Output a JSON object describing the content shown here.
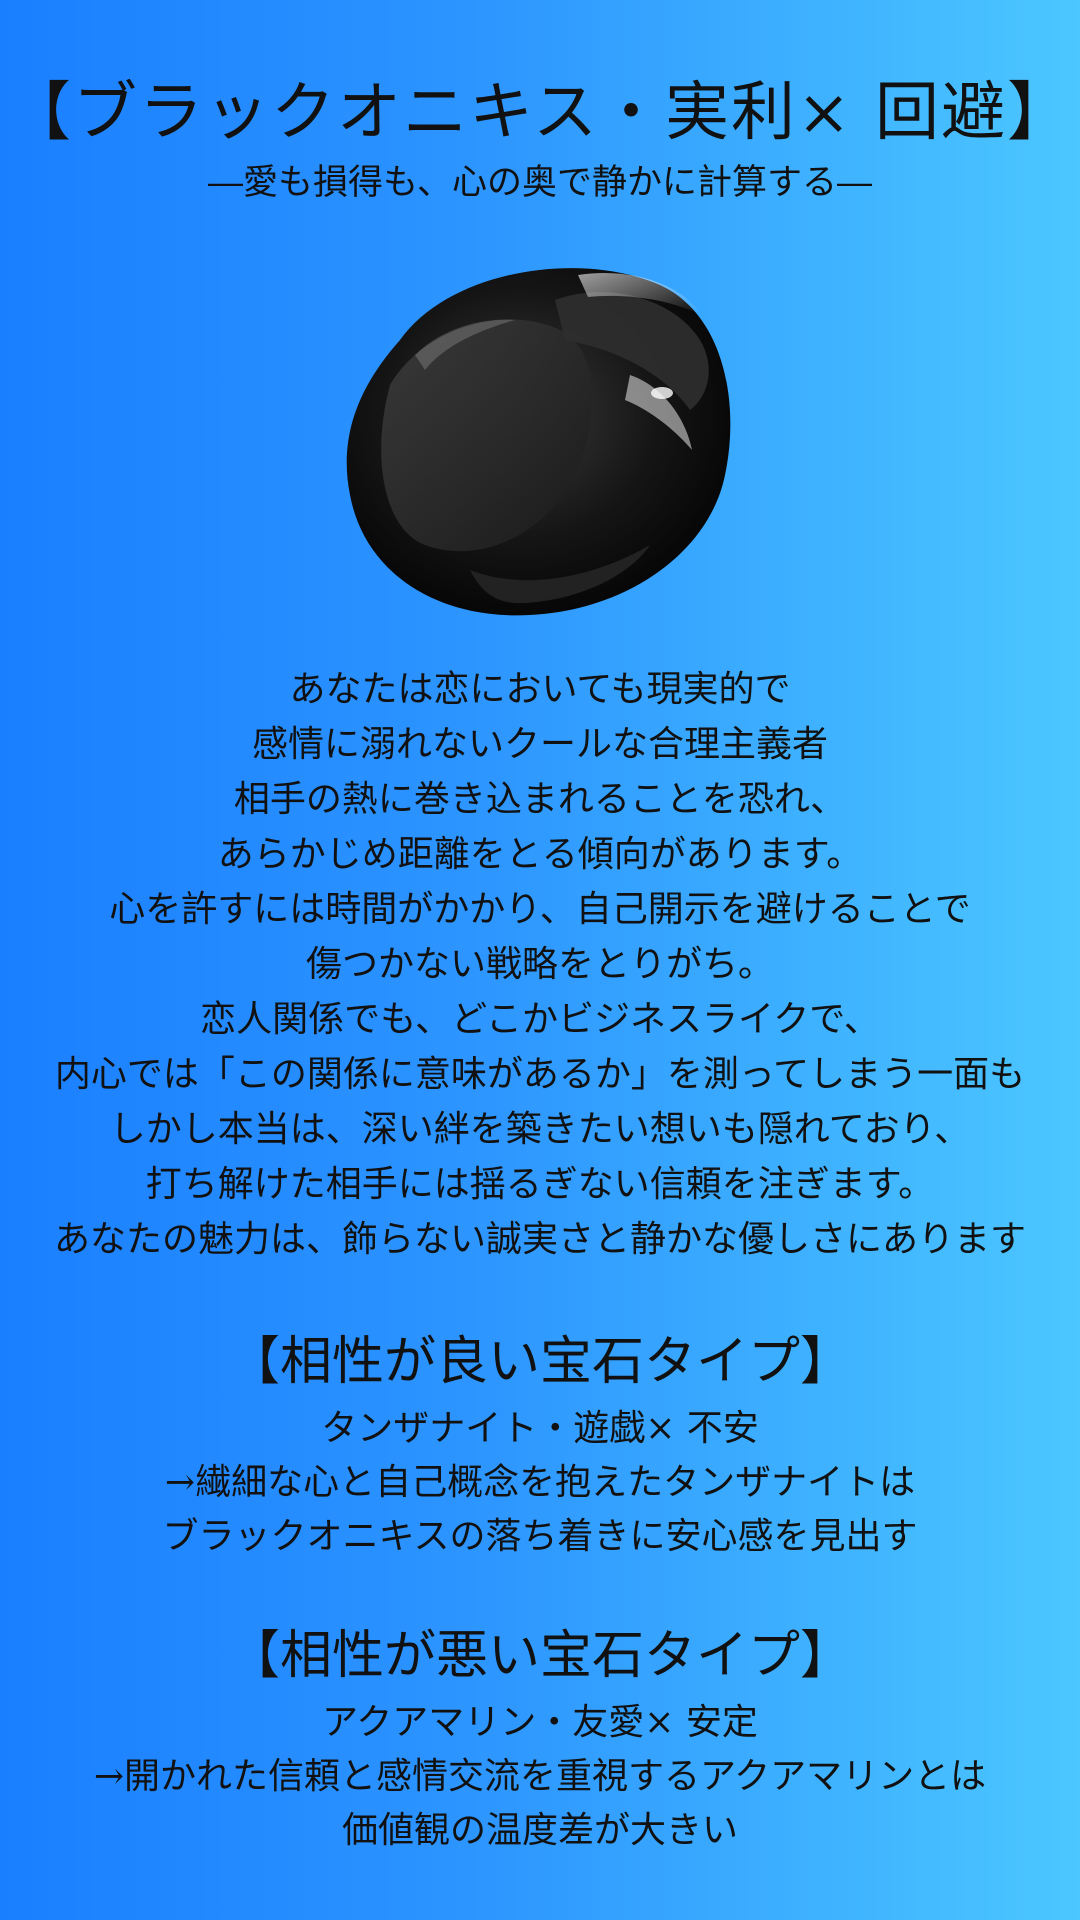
{
  "header": {
    "title": "【ブラックオニキス・実利× 回避】",
    "subtitle": "―愛も損得も、心の奥で静かに計算する―"
  },
  "image": {
    "icon": "black-onyx-stone-icon",
    "colors": {
      "stone_dark": "#050505",
      "stone_mid": "#2a2a2a",
      "highlight": "#d8d8d8"
    }
  },
  "description": {
    "lines": [
      "あなたは恋においても現実的で",
      "感情に溺れないクールな合理主義者",
      "相手の熱に巻き込まれることを恐れ、",
      "あらかじめ距離をとる傾向があります。",
      "心を許すには時間がかかり、自己開示を避けることで",
      "傷つかない戦略をとりがち。",
      "恋人関係でも、どこかビジネスライクで、",
      "内心では「この関係に意味があるか」を測ってしまう一面も",
      "しかし本当は、深い絆を築きたい想いも隠れており、",
      "打ち解けた相手には揺るぎない信頼を注ぎます。",
      "あなたの魅力は、飾らない誠実さと静かな優しさにあります"
    ]
  },
  "good_match": {
    "title": "【相性が良い宝石タイプ】",
    "lines": [
      "タンザナイト・遊戯× 不安",
      "→繊細な心と自己概念を抱えたタンザナイトは",
      "ブラックオニキスの落ち着きに安心感を見出す"
    ]
  },
  "bad_match": {
    "title": "【相性が悪い宝石タイプ】",
    "lines": [
      "アクアマリン・友愛× 安定",
      "→開かれた信頼と感情交流を重視するアクアマリンとは",
      "価値観の温度差が大きい"
    ]
  },
  "theme": {
    "gradient_left": "#1a7fff",
    "gradient_right": "#4cc7ff",
    "text_color": "#111111"
  }
}
